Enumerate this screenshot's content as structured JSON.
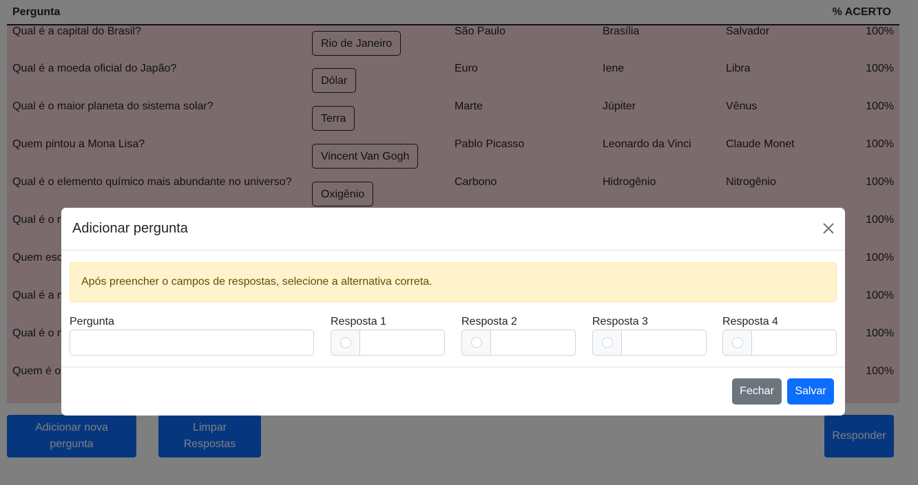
{
  "table": {
    "headers": {
      "question": "Pergunta",
      "percent": "% ACERTO"
    },
    "rows": [
      {
        "question": "Qual é a capital do Brasil?",
        "options": [
          "Rio de Janeiro",
          "São Paulo",
          "Brasília",
          "Salvador"
        ],
        "percent": "100%"
      },
      {
        "question": "Qual é a moeda oficial do Japão?",
        "options": [
          "Dólar",
          "Euro",
          "Iene",
          "Libra"
        ],
        "percent": "100%"
      },
      {
        "question": "Qual é o maior planeta do sistema solar?",
        "options": [
          "Terra",
          "Marte",
          "Júpiter",
          "Vênus"
        ],
        "percent": "100%"
      },
      {
        "question": "Quem pintou a Mona Lisa?",
        "options": [
          "Vincent Van Gogh",
          "Pablo Picasso",
          "Leonardo da Vinci",
          "Claude Monet"
        ],
        "percent": "100%"
      },
      {
        "question": "Qual é o elemento químico mais abundante no universo?",
        "options": [
          "Oxigênio",
          "Carbono",
          "Hidrogênio",
          "Nitrogênio"
        ],
        "percent": "100%"
      },
      {
        "question": "Qual é o r",
        "options": [
          "",
          "",
          "",
          ""
        ],
        "percent": "100%"
      },
      {
        "question": "Quem esc",
        "options": [
          "",
          "",
          "",
          ""
        ],
        "percent": "100%"
      },
      {
        "question": "Qual é a m",
        "options": [
          "",
          "",
          "",
          ""
        ],
        "percent": "100%"
      },
      {
        "question": "Qual é o n",
        "options": [
          "",
          "",
          "",
          ""
        ],
        "percent": "100%"
      },
      {
        "question": "Quem é o",
        "options": [
          "",
          "",
          "",
          ""
        ],
        "percent": "100%"
      }
    ]
  },
  "buttons": {
    "add_new": "Adicionar nova pergunta",
    "clear": "Limpar Respostas",
    "answer": "Responder"
  },
  "modal": {
    "title": "Adicionar pergunta",
    "alert": "Após preencher o campos de respostas, selecione a alternativa correta.",
    "labels": {
      "question": "Pergunta",
      "answer1": "Resposta 1",
      "answer2": "Resposta 2",
      "answer3": "Resposta 3",
      "answer4": "Resposta 4"
    },
    "close_label": "Fechar",
    "save_label": "Salvar"
  },
  "colors": {
    "primary": "#0d6efd",
    "secondary": "#6c757d",
    "row_bg": "#f8d7da",
    "alert_bg": "#fff3cd",
    "alert_text": "#664d03"
  }
}
